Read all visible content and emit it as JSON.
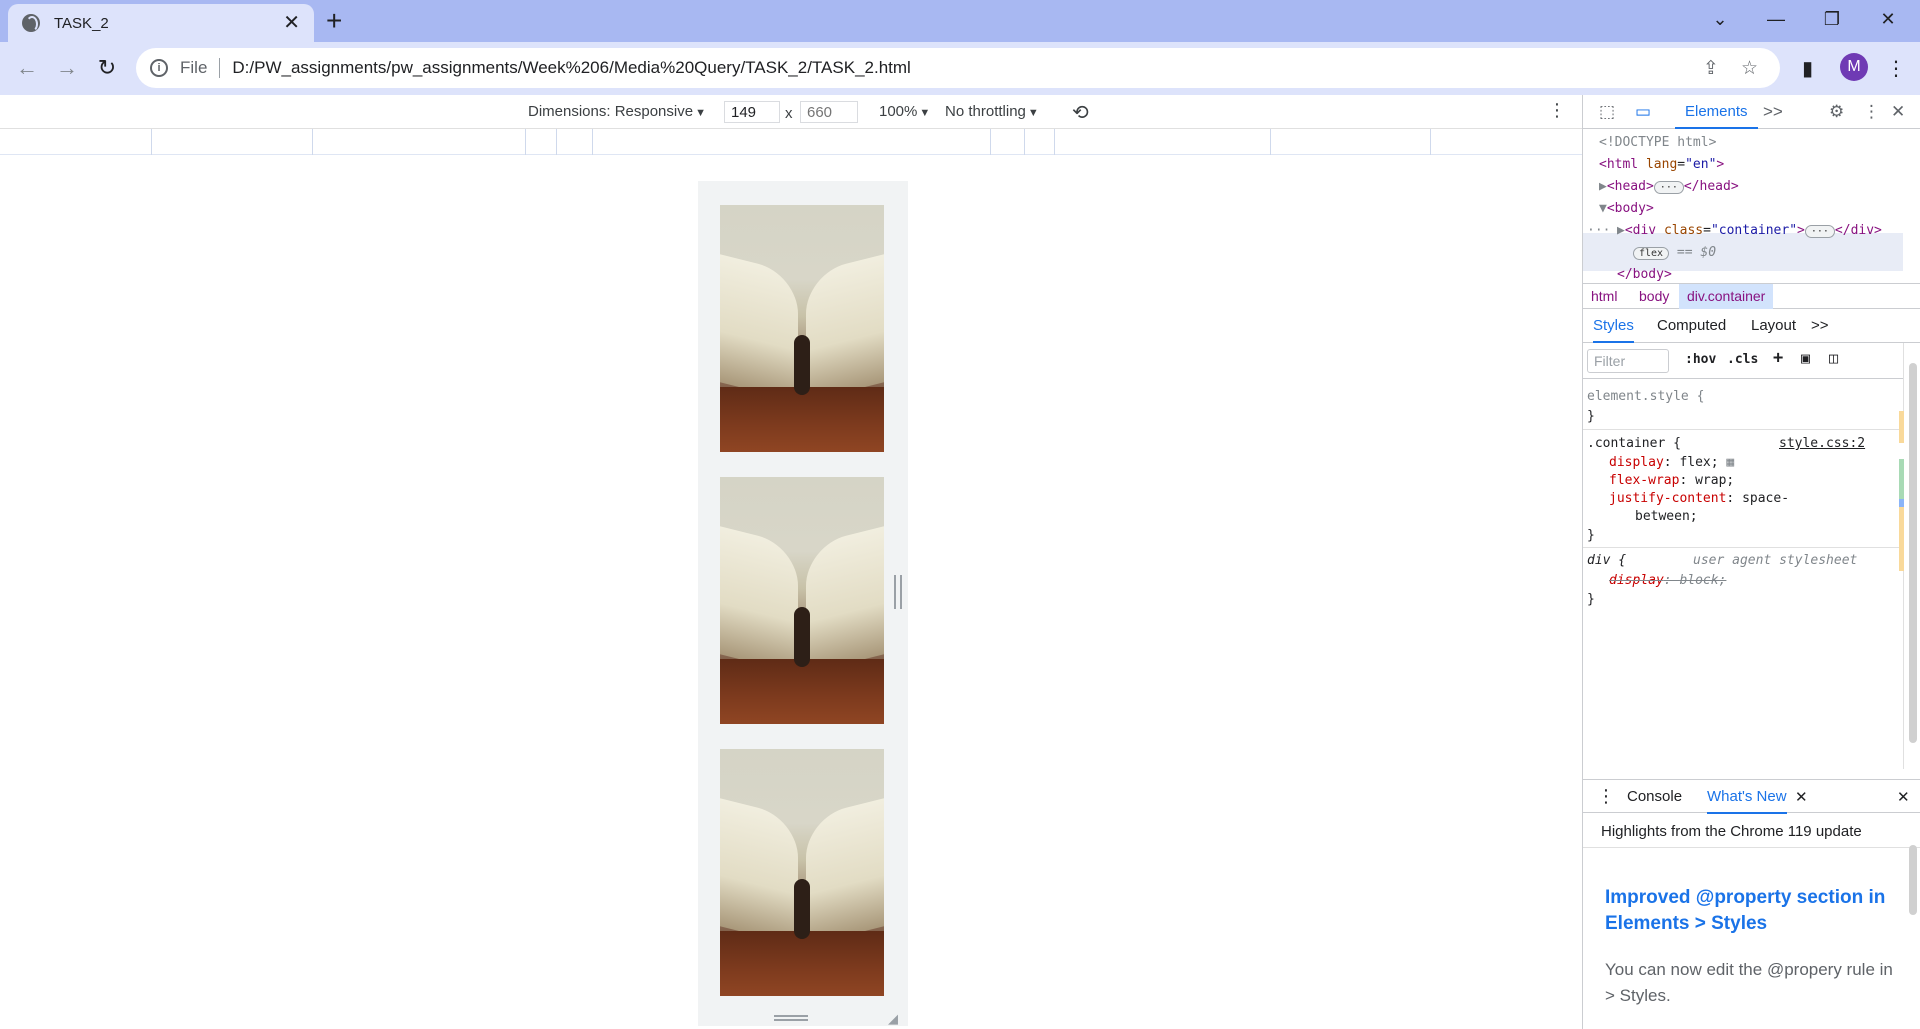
{
  "browser": {
    "tab_title": "TASK_2",
    "tab_close": "✕",
    "new_tab": "+",
    "window_controls": {
      "tabs_search": "⌄",
      "minimize": "—",
      "restore": "❐",
      "close": "✕"
    },
    "nav": {
      "back": "←",
      "forward": "→",
      "reload": "↻"
    },
    "address": {
      "scheme_label": "File",
      "url": "D:/PW_assignments/pw_assignments/Week%206/Media%20Query/TASK_2/TASK_2.html"
    },
    "profile_initial": "M"
  },
  "device_toolbar": {
    "dimensions_label": "Dimensions: Responsive",
    "width": "149",
    "times": "x",
    "height_placeholder": "660",
    "zoom": "100%",
    "throttling": "No throttling"
  },
  "page": {
    "images": [
      {
        "alt": "open book"
      },
      {
        "alt": "open book"
      },
      {
        "alt": "open book"
      }
    ]
  },
  "devtools": {
    "active_tab": "Elements",
    "more_tabs": ">>",
    "dom": {
      "doctype": "<!DOCTYPE html>",
      "html_open_tag": "<html",
      "html_attr": "lang",
      "html_attr_val": "\"en\"",
      "html_close": ">",
      "head_open": "<head>",
      "head_close": "</head>",
      "body_open": "<body>",
      "div_open": "<div",
      "div_attr": "class",
      "div_attr_val": "\"container\"",
      "div_open_end": ">",
      "div_close": "</div>",
      "flex_badge": "flex",
      "selected_marker": "== $0",
      "body_close": "</body>",
      "ellipsis": "···"
    },
    "breadcrumbs": [
      "html",
      "body",
      "div.container"
    ],
    "subtabs": [
      "Styles",
      "Computed",
      "Layout",
      ">>"
    ],
    "filter_placeholder": "Filter",
    "filter_buttons": [
      ":hov",
      ".cls"
    ],
    "styles": {
      "element_style": "element.style {",
      "close_brace": "}",
      "container_selector": ".container {",
      "container_source": "style.css:2",
      "decl1_prop": "display",
      "decl1_val": "flex;",
      "decl2_prop": "flex-wrap",
      "decl2_val": "wrap;",
      "decl3_prop": "justify-content",
      "decl3_val": "space-",
      "decl3_val_cont": "between;",
      "div_selector": "div {",
      "div_source": "user agent stylesheet",
      "div_decl_prop": "display",
      "div_decl_val": "block;"
    },
    "drawer": {
      "tabs": [
        "Console",
        "What's New"
      ],
      "active": "What's New",
      "highlights": "Highlights from the Chrome 119 update",
      "news_title_1": "Improved @property section in",
      "news_title_2": "Elements > Styles",
      "news_body_1": "You can now edit the @propery rule in",
      "news_body_2": "> Styles."
    }
  }
}
